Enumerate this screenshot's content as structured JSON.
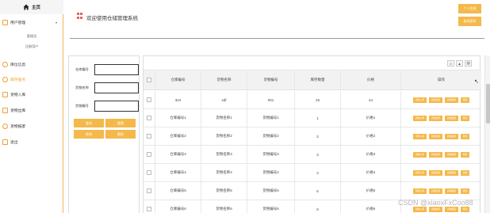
{
  "sidebar": {
    "home_label": "主页",
    "user_mgmt": {
      "label": "用户管理",
      "sub_items": [
        "管理员",
        "注册用户"
      ]
    },
    "items": [
      {
        "label": "库位信息",
        "icon": "circle-icon"
      },
      {
        "label": "库存盘点",
        "icon": "circle-icon"
      },
      {
        "label": "货物入库",
        "icon": "box-icon"
      },
      {
        "label": "货物出库",
        "icon": "box-icon"
      },
      {
        "label": "货物报废",
        "icon": "circle-icon"
      },
      {
        "label": "退出",
        "icon": "box-icon"
      }
    ],
    "active_item": "库存盘点"
  },
  "header": {
    "title": "欢迎使用仓储管理系统",
    "personal_info": "个人信息",
    "change_password": "修改密码"
  },
  "search": {
    "fields": [
      {
        "label": "仓库编号",
        "value": "",
        "placeholder": ""
      },
      {
        "label": "货物名称",
        "value": "",
        "placeholder": ""
      },
      {
        "label": "货物编号",
        "value": "",
        "placeholder": ""
      }
    ],
    "buttons": [
      "查询",
      "重置",
      "新增",
      "删除"
    ]
  },
  "table": {
    "tools": [
      "≡",
      "▲",
      "▤"
    ],
    "columns": [
      "仓库编号",
      "货物名称",
      "货物编号",
      "库存数量",
      "价格",
      "操作"
    ],
    "actions": [
      "货物入库",
      "货物出库",
      "货物报废",
      "修改"
    ],
    "rows": [
      {
        "warehouse": "324",
        "name": "sdf",
        "code": "001",
        "qty": "33",
        "price": "44"
      },
      {
        "warehouse": "仓库编号1",
        "name": "货物名称1",
        "code": "货物编号1",
        "qty": "1",
        "price": "价格1"
      },
      {
        "warehouse": "仓库编号2",
        "name": "货物名称2",
        "code": "货物编号2",
        "qty": "2",
        "price": "价格2"
      },
      {
        "warehouse": "仓库编号3",
        "name": "货物名称3",
        "code": "货物编号3",
        "qty": "3",
        "price": "价格3"
      },
      {
        "warehouse": "仓库编号4",
        "name": "货物名称4",
        "code": "货物编号4",
        "qty": "4",
        "price": "价格4"
      },
      {
        "warehouse": "仓库编号5",
        "name": "货物名称5",
        "code": "货物编号5",
        "qty": "5",
        "price": "价格5"
      },
      {
        "warehouse": "仓库编号6",
        "name": "货物名称6",
        "code": "货物编号6",
        "qty": "6",
        "price": "价格6"
      }
    ]
  },
  "watermark": "CSDN @xiaoxFxCoo88",
  "colors": {
    "accent": "#f5b84a",
    "active_text": "#f0a030"
  }
}
